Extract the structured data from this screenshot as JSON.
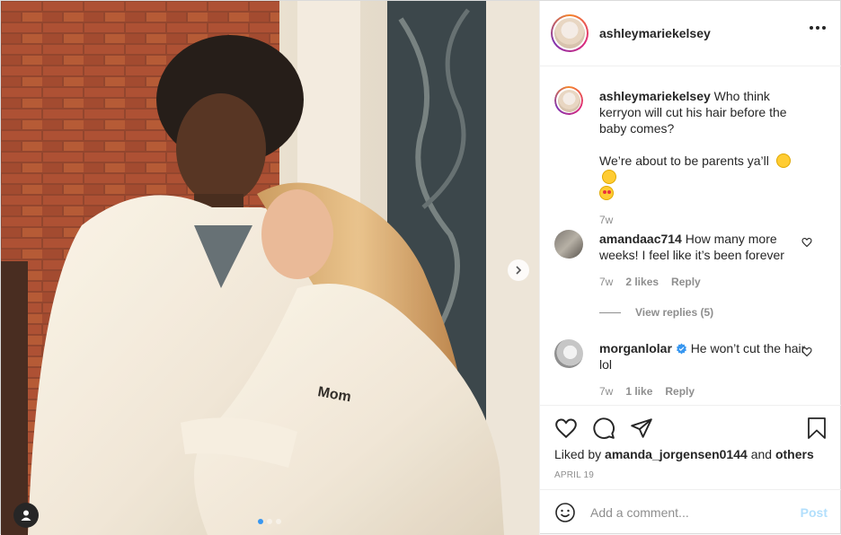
{
  "post": {
    "username": "ashleymariekelsey",
    "caption_line1": "Who think kerryon will cut his hair before the baby comes?",
    "caption_line2": "We’re about to be parents ya’ll",
    "caption_time": "7w",
    "liked_by_prefix": "Liked by",
    "liked_by_user": "amanda_jorgensen0144",
    "liked_by_and": "and",
    "liked_by_others": "others",
    "date": "APRIL 19",
    "carousel_total": 3,
    "carousel_index": 1
  },
  "comments": [
    {
      "username": "amandaac714",
      "text": "How many more weeks! I feel like it’s been forever",
      "time": "7w",
      "likes": "2 likes",
      "reply_label": "Reply",
      "view_replies": "View replies (5)"
    },
    {
      "username": "morganlolar",
      "verified": true,
      "text": "He won’t cut the hair lol",
      "time": "7w",
      "likes": "1 like",
      "reply_label": "Reply"
    }
  ],
  "add_comment": {
    "placeholder": "Add a comment...",
    "post_label": "Post"
  },
  "colors": {
    "verified": "#3897f0",
    "post_disabled": "#b2dffc",
    "muted": "#8e8e8e"
  }
}
